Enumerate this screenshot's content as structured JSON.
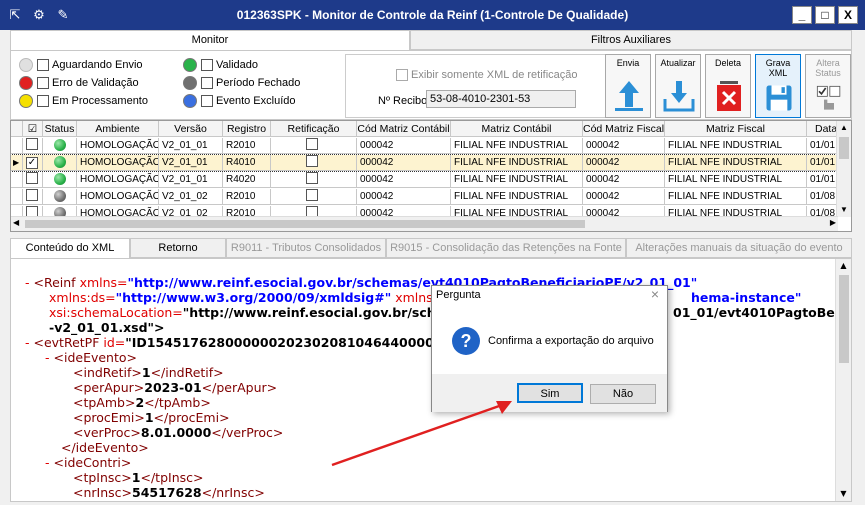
{
  "window": {
    "title": "012363SPK - Monitor de Controle da Reinf (1-Controle De Qualidade)",
    "minimize": "_",
    "maximize": "□",
    "close": "X"
  },
  "tabs_top": [
    "Monitor",
    "Filtros Auxiliares"
  ],
  "legend": {
    "items": [
      {
        "label": "Aguardando Envio",
        "color": "#e0e0e0"
      },
      {
        "label": "Erro de Validação",
        "color": "#e02020"
      },
      {
        "label": "Em Processamento",
        "color": "#f5e000"
      },
      {
        "label": "Validado",
        "color": "#2ab24a"
      },
      {
        "label": "Período Fechado",
        "color": "#707070"
      },
      {
        "label": "Evento Excluído",
        "color": "#3a6fe0"
      }
    ]
  },
  "filter": {
    "show_xml_label": "Exibir somente XML de retificação",
    "recibo_label": "Nº Recibo:",
    "recibo_value": "53-08-4010-2301-53"
  },
  "toolbar": {
    "envia": "Envia",
    "atualizar": "Atualizar",
    "deleta": "Deleta",
    "grava_xml": "Grava\nXML",
    "altera_status": "Altera\nStatus"
  },
  "grid": {
    "headers": [
      "☑",
      "Status",
      "Ambiente",
      "Versão",
      "Registro",
      "Retificação",
      "Cód Matriz Contábil",
      "Matriz Contábil",
      "Cód Matriz Fiscal",
      "Matriz Fiscal",
      "Data I"
    ],
    "rows": [
      {
        "checked": false,
        "status": "#2ab24a",
        "ambiente": "HOMOLOGAÇÃO",
        "versao": "V2_01_01",
        "registro": "R2010",
        "cod_cont": "000042",
        "matriz_cont": "FILIAL NFE INDUSTRIAL",
        "cod_fisc": "000042",
        "matriz_fisc": "FILIAL NFE INDUSTRIAL",
        "data": "01/01"
      },
      {
        "checked": true,
        "status": "#2ab24a",
        "ambiente": "HOMOLOGAÇÃO",
        "versao": "V2_01_01",
        "registro": "R4010",
        "cod_cont": "000042",
        "matriz_cont": "FILIAL NFE INDUSTRIAL",
        "cod_fisc": "000042",
        "matriz_fisc": "FILIAL NFE INDUSTRIAL",
        "data": "01/01"
      },
      {
        "checked": false,
        "status": "#2ab24a",
        "ambiente": "HOMOLOGAÇÃO",
        "versao": "V2_01_01",
        "registro": "R4020",
        "cod_cont": "000042",
        "matriz_cont": "FILIAL NFE INDUSTRIAL",
        "cod_fisc": "000042",
        "matriz_fisc": "FILIAL NFE INDUSTRIAL",
        "data": "01/01"
      },
      {
        "checked": false,
        "status": "#707070",
        "ambiente": "HOMOLOGAÇÃO",
        "versao": "V2_01_02",
        "registro": "R2010",
        "cod_cont": "000042",
        "matriz_cont": "FILIAL NFE INDUSTRIAL",
        "cod_fisc": "000042",
        "matriz_fisc": "FILIAL NFE INDUSTRIAL",
        "data": "01/08"
      },
      {
        "checked": false,
        "status": "#707070",
        "ambiente": "HOMOLOGAÇÃO",
        "versao": "V2_01_02",
        "registro": "R2010",
        "cod_cont": "000042",
        "matriz_cont": "FILIAL NFE INDUSTRIAL",
        "cod_fisc": "000042",
        "matriz_fisc": "FILIAL NFE INDUSTRIAL",
        "data": "01/08"
      }
    ]
  },
  "tabs_bottom": [
    "Conteúdo do XML",
    "Retorno",
    "R9011 - Tributos Consolidados",
    "R9015 - Consolidação das Retenções na Fonte",
    "Alterações manuais da situação do evento"
  ],
  "xml": {
    "l1_tag": "<Reinf",
    "l1_attr": " xmlns=",
    "l1_val": "\"http://www.reinf.esocial.gov.br/schemas/evt4010PagtoBeneficiarioPF/v2_01_01\"",
    "l2_attr": "xmlns:ds=",
    "l2_val": "\"http://www.w3.org/2000/09/xmldsig#\"",
    "l2_attr2": " xmlns:xsi",
    "l2_tail": "hema-instance\"",
    "l3_attr": "xsi:schemaLocation=",
    "l3_val": "\"http://www.reinf.esocial.gov.br/schem",
    "l3_tail": "01_01/evt4010PagtoBen",
    "l4": "-v2_01_01.xsd\">",
    "l5_tag": "<evtRetPF",
    "l5_attr": " id=",
    "l5_val": "\"ID15451762800000020230208104644000001\">",
    "ideEvento_open": "<ideEvento>",
    "indRetif": [
      "<indRetif>",
      "1",
      "</indRetif>"
    ],
    "perApur": [
      "<perApur>",
      "2023-01",
      "</perApur>"
    ],
    "tpAmb": [
      "<tpAmb>",
      "2",
      "</tpAmb>"
    ],
    "procEmi": [
      "<procEmi>",
      "1",
      "</procEmi>"
    ],
    "verProc": [
      "<verProc>",
      "8.01.0000",
      "</verProc>"
    ],
    "ideEvento_close": "</ideEvento>",
    "ideContri_open": "<ideContri>",
    "tpInsc": [
      "<tpInsc>",
      "1",
      "</tpInsc>"
    ],
    "nrInsc": [
      "<nrInsc>",
      "54517628",
      "</nrInsc>"
    ],
    "minus": "-"
  },
  "dialog": {
    "title": "Pergunta",
    "close": "×",
    "icon": "?",
    "message": "Confirma a exportação do arquivo",
    "yes": "Sim",
    "no": "Não"
  },
  "colors": {
    "titlebar": "#1e3a8a",
    "annotation_arrow": "#e02020",
    "selected_row": "#fdf3d0"
  }
}
